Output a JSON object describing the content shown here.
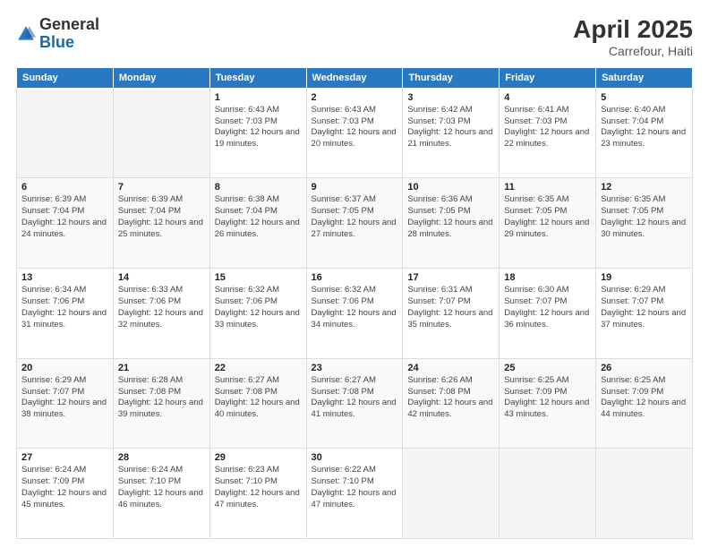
{
  "logo": {
    "general": "General",
    "blue": "Blue"
  },
  "header": {
    "title": "April 2025",
    "location": "Carrefour, Haiti"
  },
  "weekdays": [
    "Sunday",
    "Monday",
    "Tuesday",
    "Wednesday",
    "Thursday",
    "Friday",
    "Saturday"
  ],
  "weeks": [
    [
      {
        "day": "",
        "info": ""
      },
      {
        "day": "",
        "info": ""
      },
      {
        "day": "1",
        "info": "Sunrise: 6:43 AM\nSunset: 7:03 PM\nDaylight: 12 hours and 19 minutes."
      },
      {
        "day": "2",
        "info": "Sunrise: 6:43 AM\nSunset: 7:03 PM\nDaylight: 12 hours and 20 minutes."
      },
      {
        "day": "3",
        "info": "Sunrise: 6:42 AM\nSunset: 7:03 PM\nDaylight: 12 hours and 21 minutes."
      },
      {
        "day": "4",
        "info": "Sunrise: 6:41 AM\nSunset: 7:03 PM\nDaylight: 12 hours and 22 minutes."
      },
      {
        "day": "5",
        "info": "Sunrise: 6:40 AM\nSunset: 7:04 PM\nDaylight: 12 hours and 23 minutes."
      }
    ],
    [
      {
        "day": "6",
        "info": "Sunrise: 6:39 AM\nSunset: 7:04 PM\nDaylight: 12 hours and 24 minutes."
      },
      {
        "day": "7",
        "info": "Sunrise: 6:39 AM\nSunset: 7:04 PM\nDaylight: 12 hours and 25 minutes."
      },
      {
        "day": "8",
        "info": "Sunrise: 6:38 AM\nSunset: 7:04 PM\nDaylight: 12 hours and 26 minutes."
      },
      {
        "day": "9",
        "info": "Sunrise: 6:37 AM\nSunset: 7:05 PM\nDaylight: 12 hours and 27 minutes."
      },
      {
        "day": "10",
        "info": "Sunrise: 6:36 AM\nSunset: 7:05 PM\nDaylight: 12 hours and 28 minutes."
      },
      {
        "day": "11",
        "info": "Sunrise: 6:35 AM\nSunset: 7:05 PM\nDaylight: 12 hours and 29 minutes."
      },
      {
        "day": "12",
        "info": "Sunrise: 6:35 AM\nSunset: 7:05 PM\nDaylight: 12 hours and 30 minutes."
      }
    ],
    [
      {
        "day": "13",
        "info": "Sunrise: 6:34 AM\nSunset: 7:06 PM\nDaylight: 12 hours and 31 minutes."
      },
      {
        "day": "14",
        "info": "Sunrise: 6:33 AM\nSunset: 7:06 PM\nDaylight: 12 hours and 32 minutes."
      },
      {
        "day": "15",
        "info": "Sunrise: 6:32 AM\nSunset: 7:06 PM\nDaylight: 12 hours and 33 minutes."
      },
      {
        "day": "16",
        "info": "Sunrise: 6:32 AM\nSunset: 7:06 PM\nDaylight: 12 hours and 34 minutes."
      },
      {
        "day": "17",
        "info": "Sunrise: 6:31 AM\nSunset: 7:07 PM\nDaylight: 12 hours and 35 minutes."
      },
      {
        "day": "18",
        "info": "Sunrise: 6:30 AM\nSunset: 7:07 PM\nDaylight: 12 hours and 36 minutes."
      },
      {
        "day": "19",
        "info": "Sunrise: 6:29 AM\nSunset: 7:07 PM\nDaylight: 12 hours and 37 minutes."
      }
    ],
    [
      {
        "day": "20",
        "info": "Sunrise: 6:29 AM\nSunset: 7:07 PM\nDaylight: 12 hours and 38 minutes."
      },
      {
        "day": "21",
        "info": "Sunrise: 6:28 AM\nSunset: 7:08 PM\nDaylight: 12 hours and 39 minutes."
      },
      {
        "day": "22",
        "info": "Sunrise: 6:27 AM\nSunset: 7:08 PM\nDaylight: 12 hours and 40 minutes."
      },
      {
        "day": "23",
        "info": "Sunrise: 6:27 AM\nSunset: 7:08 PM\nDaylight: 12 hours and 41 minutes."
      },
      {
        "day": "24",
        "info": "Sunrise: 6:26 AM\nSunset: 7:08 PM\nDaylight: 12 hours and 42 minutes."
      },
      {
        "day": "25",
        "info": "Sunrise: 6:25 AM\nSunset: 7:09 PM\nDaylight: 12 hours and 43 minutes."
      },
      {
        "day": "26",
        "info": "Sunrise: 6:25 AM\nSunset: 7:09 PM\nDaylight: 12 hours and 44 minutes."
      }
    ],
    [
      {
        "day": "27",
        "info": "Sunrise: 6:24 AM\nSunset: 7:09 PM\nDaylight: 12 hours and 45 minutes."
      },
      {
        "day": "28",
        "info": "Sunrise: 6:24 AM\nSunset: 7:10 PM\nDaylight: 12 hours and 46 minutes."
      },
      {
        "day": "29",
        "info": "Sunrise: 6:23 AM\nSunset: 7:10 PM\nDaylight: 12 hours and 47 minutes."
      },
      {
        "day": "30",
        "info": "Sunrise: 6:22 AM\nSunset: 7:10 PM\nDaylight: 12 hours and 47 minutes."
      },
      {
        "day": "",
        "info": ""
      },
      {
        "day": "",
        "info": ""
      },
      {
        "day": "",
        "info": ""
      }
    ]
  ]
}
